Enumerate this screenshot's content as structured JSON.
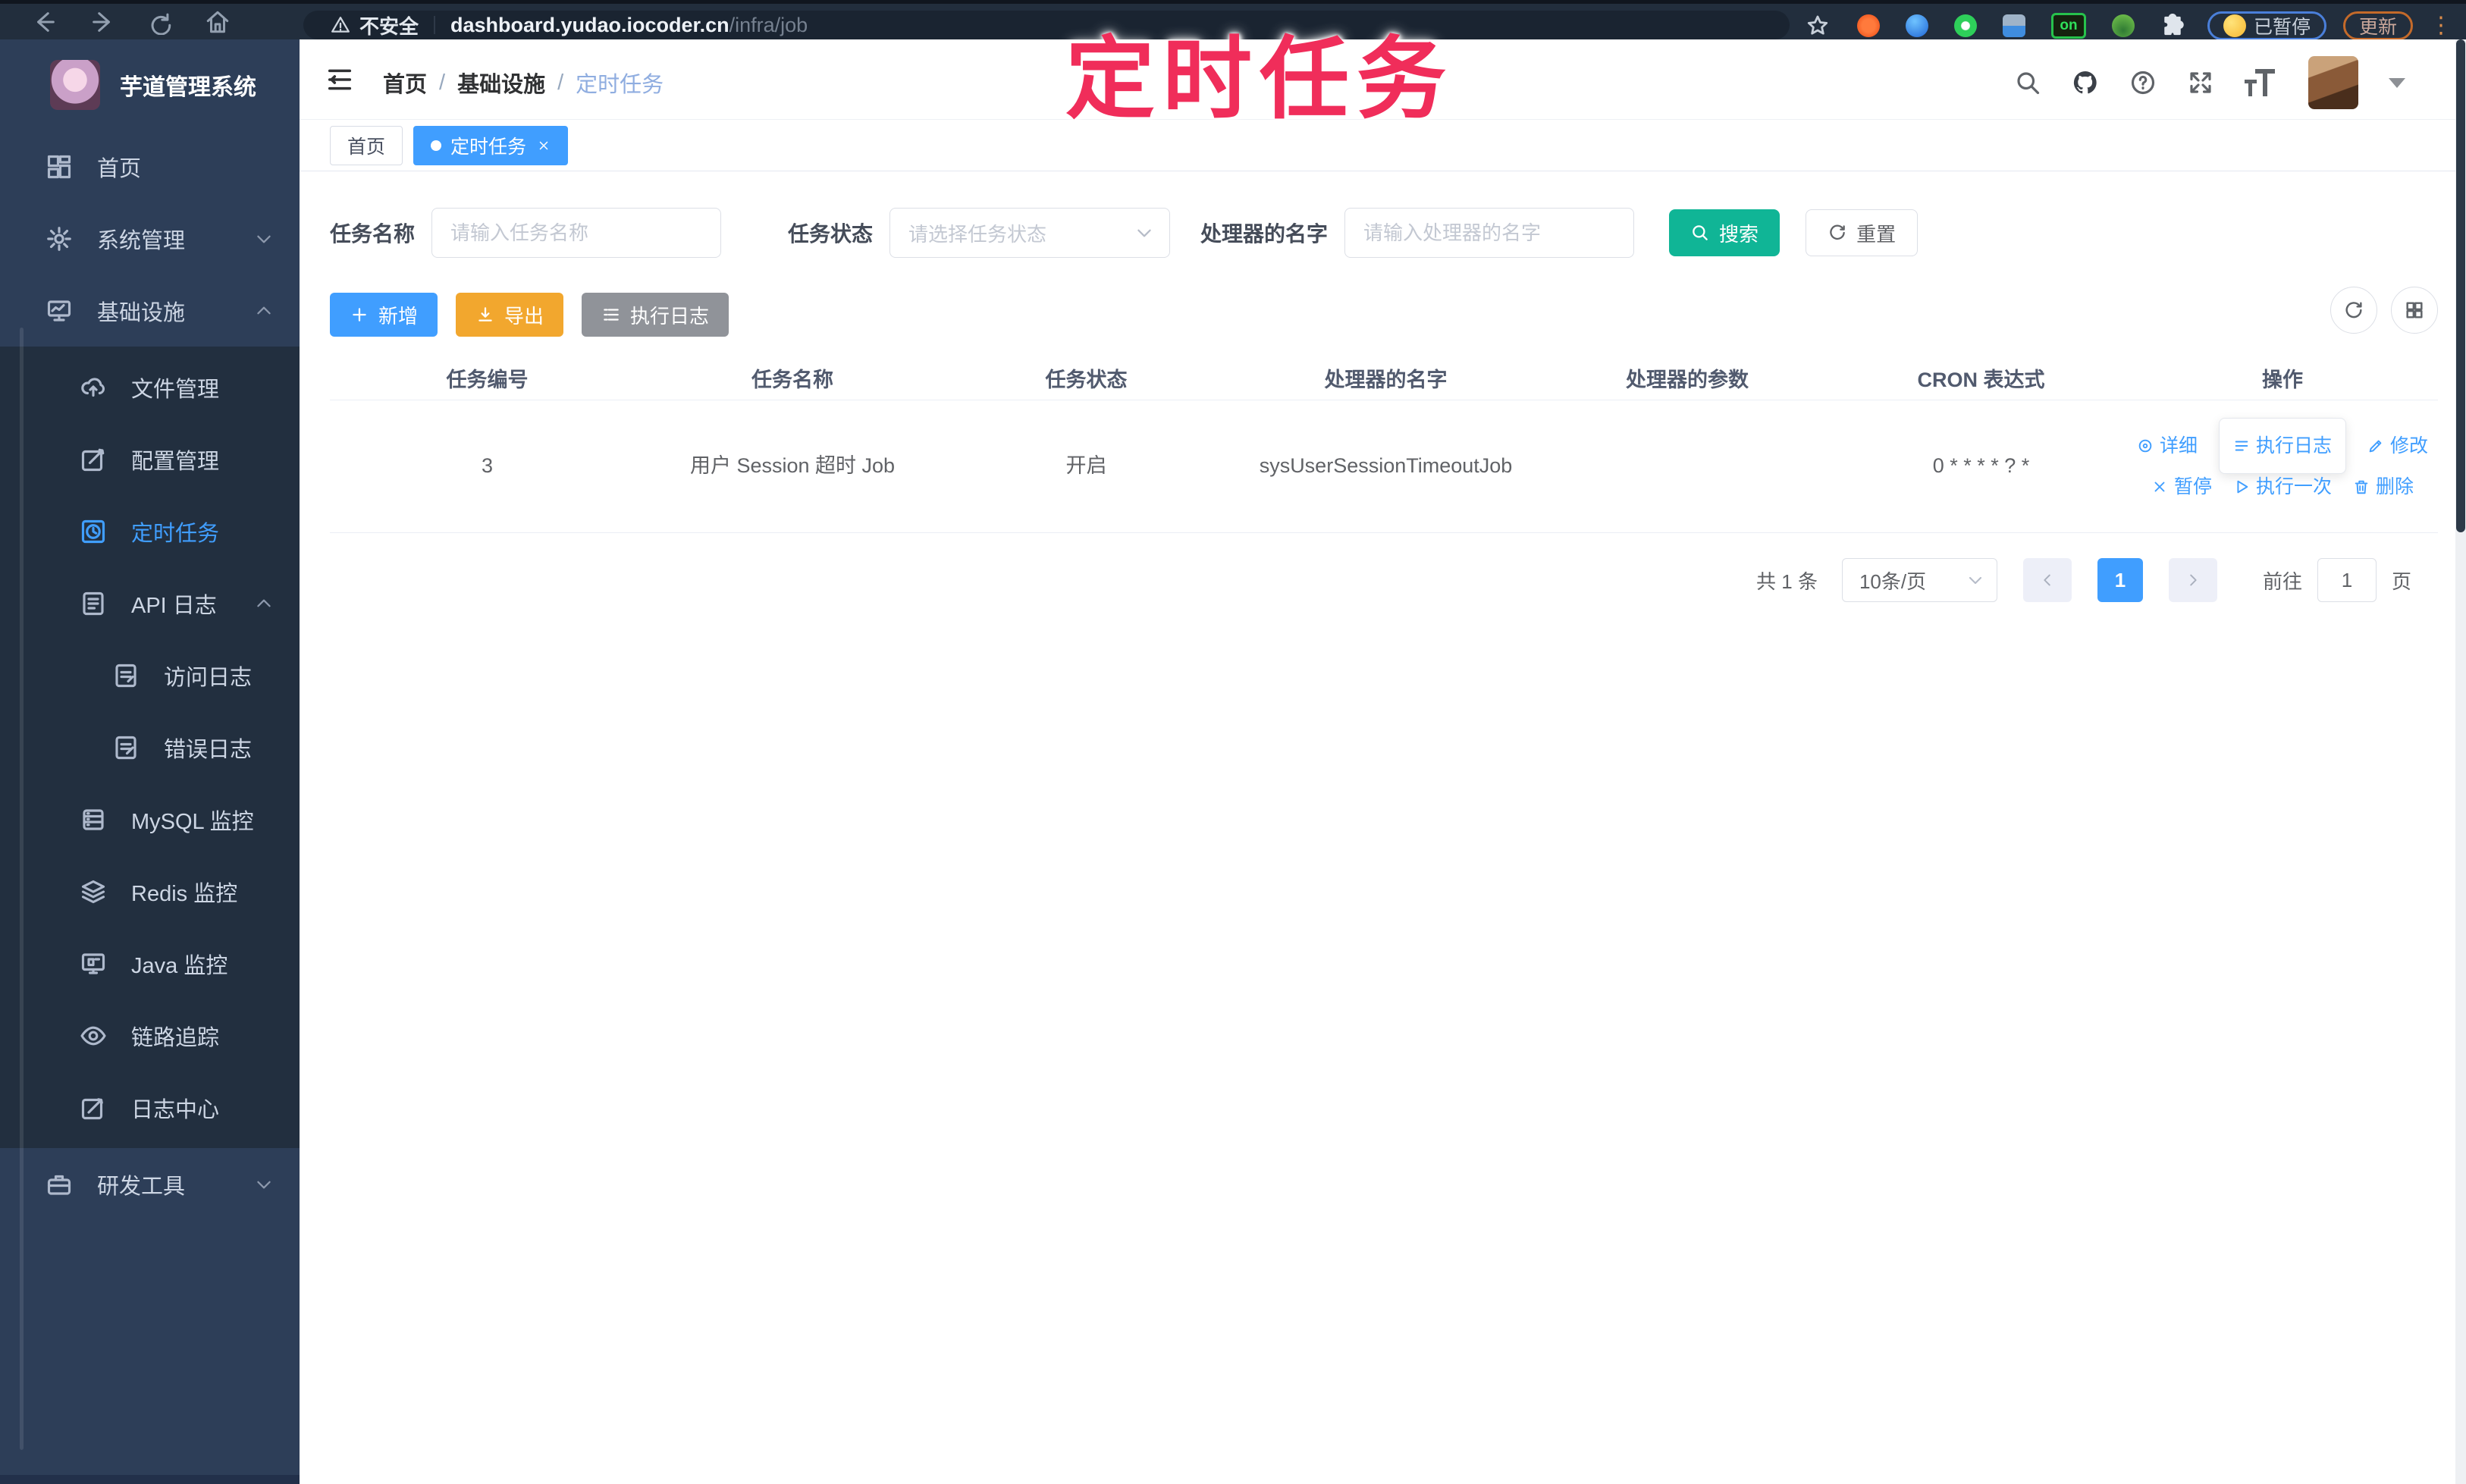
{
  "browser": {
    "security_label": "不安全",
    "url_host": "dashboard.yudao.iocoder.cn",
    "url_path": "/infra/job",
    "extension_on_label": "on",
    "paused_badge": "已暂停",
    "update_button": "更新"
  },
  "annotation": {
    "text": "定时任务",
    "color": "#f02d5a"
  },
  "sidebar": {
    "title": "芋道管理系统",
    "items": [
      {
        "label": "首页"
      },
      {
        "label": "系统管理"
      },
      {
        "label": "基础设施"
      },
      {
        "label": "文件管理"
      },
      {
        "label": "配置管理"
      },
      {
        "label": "定时任务"
      },
      {
        "label": "API 日志"
      },
      {
        "label": "访问日志"
      },
      {
        "label": "错误日志"
      },
      {
        "label": "MySQL 监控"
      },
      {
        "label": "Redis 监控"
      },
      {
        "label": "Java 监控"
      },
      {
        "label": "链路追踪"
      },
      {
        "label": "日志中心"
      },
      {
        "label": "研发工具"
      }
    ]
  },
  "header": {
    "breadcrumb": [
      "首页",
      "基础设施",
      "定时任务"
    ]
  },
  "tabs": [
    {
      "label": "首页",
      "active": false
    },
    {
      "label": "定时任务",
      "active": true
    }
  ],
  "filters": {
    "name_label": "任务名称",
    "name_placeholder": "请输入任务名称",
    "status_label": "任务状态",
    "status_placeholder": "请选择任务状态",
    "handler_label": "处理器的名字",
    "handler_placeholder": "请输入处理器的名字",
    "search_label": "搜索",
    "reset_label": "重置"
  },
  "toolbar": {
    "add": "新增",
    "export": "导出",
    "exec_log": "执行日志"
  },
  "table": {
    "columns": [
      "任务编号",
      "任务名称",
      "任务状态",
      "处理器的名字",
      "处理器的参数",
      "CRON 表达式",
      "操作"
    ],
    "rows": [
      {
        "id": "3",
        "name": "用户 Session 超时 Job",
        "status": "开启",
        "handler": "sysUserSessionTimeoutJob",
        "param": "",
        "cron": "0 * * * * ? *",
        "actions": [
          "详细",
          "执行日志",
          "修改",
          "暂停",
          "执行一次",
          "删除"
        ]
      }
    ]
  },
  "pagination": {
    "total": "共 1 条",
    "page_size": "10条/页",
    "current": "1",
    "goto_label": "前往",
    "goto_value": "1",
    "page_label": "页"
  },
  "colors": {
    "primary": "#409EFF",
    "warning": "#f2a72e",
    "info": "#909399",
    "search_teal": "#10b596",
    "sidebar_bg": "#2d3e58",
    "submenu_bg": "#222f3f",
    "annotation_pink": "#f02d5a"
  }
}
